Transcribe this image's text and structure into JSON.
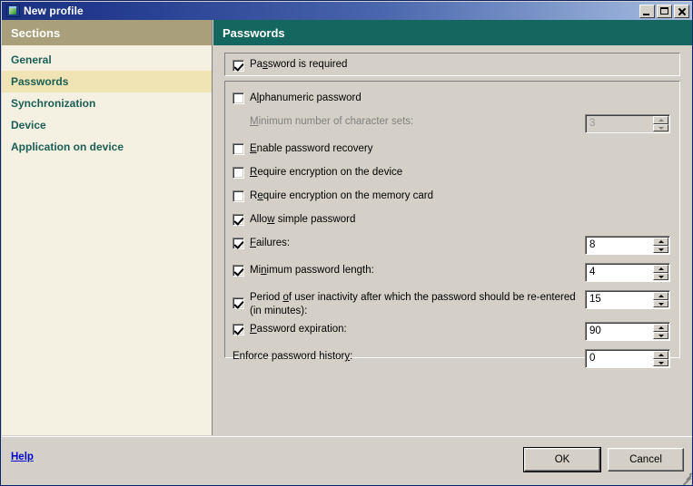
{
  "window": {
    "title": "New profile",
    "icon": "window-profile-icon",
    "controls": {
      "minimize": "Minimize",
      "maximize": "Maximize",
      "close": "Close"
    }
  },
  "sidebar": {
    "header": "Sections",
    "items": [
      {
        "label": "General",
        "active": false
      },
      {
        "label": "Passwords",
        "active": true
      },
      {
        "label": "Synchronization",
        "active": false
      },
      {
        "label": "Device",
        "active": false
      },
      {
        "label": "Application on device",
        "active": false
      }
    ]
  },
  "content": {
    "header": "Passwords",
    "password_required": {
      "label": "Password is required",
      "accel_before": "Pa",
      "accel": "s",
      "accel_after": "sword is required",
      "checked": true
    },
    "options": [
      {
        "id": "alphanumeric-password",
        "type": "checkbox",
        "checked": false,
        "accel_before": "A",
        "accel": "l",
        "accel_after": "phanumeric password",
        "label": "Alphanumeric password"
      },
      {
        "id": "minimum-character-sets",
        "type": "label-spinner",
        "indent": true,
        "disabled": true,
        "accel_before": "",
        "accel": "M",
        "accel_after": "inimum number of character sets:",
        "label": "Minimum number of character sets:",
        "value": "3"
      },
      {
        "id": "enable-password-recovery",
        "type": "checkbox",
        "checked": false,
        "accel_before": "",
        "accel": "E",
        "accel_after": "nable password recovery",
        "label": "Enable password recovery"
      },
      {
        "id": "require-encryption-device",
        "type": "checkbox",
        "checked": false,
        "accel_before": "",
        "accel": "R",
        "accel_after": "equire encryption on the device",
        "label": "Require encryption on the device"
      },
      {
        "id": "require-encryption-memory-card",
        "type": "checkbox",
        "checked": false,
        "accel_before": "R",
        "accel": "e",
        "accel_after": "quire encryption on the memory card",
        "label": "Require encryption on the memory card"
      },
      {
        "id": "allow-simple-password",
        "type": "checkbox",
        "checked": true,
        "accel_before": "Allo",
        "accel": "w",
        "accel_after": " simple password",
        "label": "Allow simple password"
      },
      {
        "id": "failures",
        "type": "checkbox-spinner",
        "checked": true,
        "accel_before": "",
        "accel": "F",
        "accel_after": "ailures:",
        "label": "Failures:",
        "value": "8"
      },
      {
        "id": "minimum-password-length",
        "type": "checkbox-spinner",
        "checked": true,
        "accel_before": "Mi",
        "accel": "n",
        "accel_after": "imum password length:",
        "label": "Minimum password length:",
        "value": "4"
      },
      {
        "id": "inactivity-period",
        "type": "checkbox-spinner",
        "checked": true,
        "two_line": true,
        "accel_before": "Period ",
        "accel": "o",
        "accel_after": "f user inactivity after which the password should be re-entered (in minutes):",
        "label": "Period of user inactivity after which the password should be re-entered (in minutes):",
        "value": "15"
      },
      {
        "id": "password-expiration",
        "type": "checkbox-spinner",
        "checked": true,
        "accel_before": "",
        "accel": "P",
        "accel_after": "assword expiration:",
        "label": "Password expiration:",
        "value": "90"
      },
      {
        "id": "enforce-password-history",
        "type": "label-spinner",
        "indent": false,
        "disabled": false,
        "accel_before": "Enforce password histor",
        "accel": "y",
        "accel_after": ":",
        "label": "Enforce password history:",
        "value": "0"
      }
    ]
  },
  "footer": {
    "help": "Help",
    "ok": "OK",
    "cancel": "Cancel"
  },
  "colors": {
    "titlebar_start": "#1b3180",
    "titlebar_end": "#a9bcdd",
    "sidebar_header": "#a99f7b",
    "sidebar_body": "#f4f1e3",
    "sidebar_active": "#f0e4b4",
    "sidebar_text": "#1b5e55",
    "content_header": "#14675f",
    "dialog_face": "#d4d0c8",
    "link": "#0000cc"
  }
}
